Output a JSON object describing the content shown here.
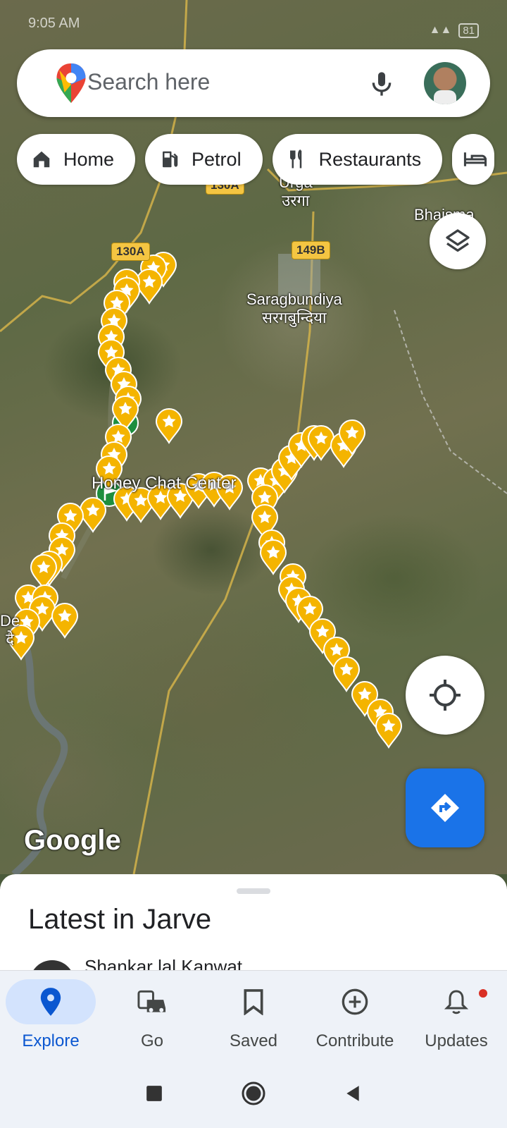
{
  "status_bar": {
    "time": "9:05 AM",
    "battery": "81"
  },
  "search": {
    "placeholder": "Search here"
  },
  "chips": [
    {
      "label": "Home",
      "icon": "home-icon"
    },
    {
      "label": "Petrol",
      "icon": "fuel-icon"
    },
    {
      "label": "Restaurants",
      "icon": "restaurant-icon"
    },
    {
      "label": "",
      "icon": "hotel-icon"
    }
  ],
  "map": {
    "labels": {
      "urga_en": "Urga",
      "urga_hi": "उरगा",
      "saragbundiya_en": "Saragbundiya",
      "saragbundiya_hi": "सरगबुन्दिया",
      "bhaisma": "Bhaisma",
      "honey_chat": "Honey Chat Center",
      "de": "De",
      "de_hi": "दे"
    },
    "shields": {
      "road1": "130A",
      "road2": "149B",
      "road3": "130A"
    },
    "logo": "Google"
  },
  "sheet": {
    "title": "Latest in Jarve",
    "peek_name": "Shankar lal Kanwat"
  },
  "nav": {
    "explore": "Explore",
    "go": "Go",
    "saved": "Saved",
    "contribute": "Contribute",
    "updates": "Updates"
  },
  "colors": {
    "accent": "#1a73e8",
    "marker": "#f4b400",
    "nav_active": "#0b57d0"
  }
}
